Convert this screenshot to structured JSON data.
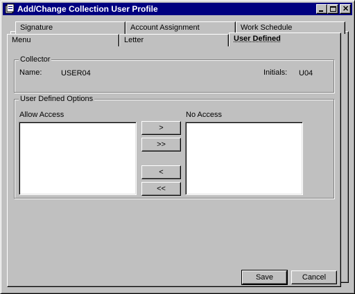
{
  "window": {
    "title": "Add/Change Collection User Profile"
  },
  "tabs": {
    "back_row": [
      "Signature",
      "Account Assignment",
      "Work Schedule"
    ],
    "front_row": [
      "Menu",
      "Letter",
      "User Defined"
    ],
    "active": "User Defined"
  },
  "collector": {
    "legend": "Collector",
    "name_label": "Name:",
    "name_value": "USER04",
    "initials_label": "Initials:",
    "initials_value": "U04"
  },
  "options": {
    "legend": "User Defined Options",
    "allow_label": "Allow Access",
    "no_access_label": "No Access",
    "allow_items": [],
    "no_access_items": [],
    "move_one_right": ">",
    "move_all_right": ">>",
    "move_one_left": "<",
    "move_all_left": "<<"
  },
  "footer": {
    "save_label": "Save",
    "cancel_label": "Cancel"
  },
  "icons": {
    "app": "app-icon",
    "minimize": "minimize-icon",
    "maximize": "maximize-icon",
    "close": "close-icon"
  }
}
